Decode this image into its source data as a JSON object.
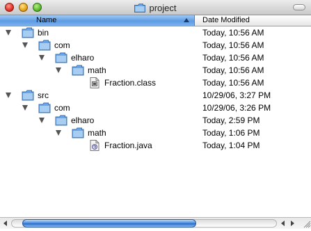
{
  "window": {
    "title": "project",
    "title_icon": "folder-icon"
  },
  "columns": {
    "name": "Name",
    "date_modified": "Date Modified",
    "sort": "ascending"
  },
  "rows": [
    {
      "name": "bin",
      "date": "Today, 10:56 AM",
      "type": "folder",
      "expanded": true
    },
    {
      "name": "com",
      "date": "Today, 10:56 AM",
      "type": "folder",
      "expanded": true
    },
    {
      "name": "elharo",
      "date": "Today, 10:56 AM",
      "type": "folder",
      "expanded": true
    },
    {
      "name": "math",
      "date": "Today, 10:56 AM",
      "type": "folder",
      "expanded": true
    },
    {
      "name": "Fraction.class",
      "date": "Today, 10:56 AM",
      "type": "class-file"
    },
    {
      "name": "src",
      "date": "10/29/06, 3:27 PM",
      "type": "folder",
      "expanded": true
    },
    {
      "name": "com",
      "date": "10/29/06, 3:26 PM",
      "type": "folder",
      "expanded": true
    },
    {
      "name": "elharo",
      "date": "Today, 2:59 PM",
      "type": "folder",
      "expanded": true
    },
    {
      "name": "math",
      "date": "Today, 1:06 PM",
      "type": "folder",
      "expanded": true
    },
    {
      "name": "Fraction.java",
      "date": "Today, 1:04 PM",
      "type": "java-file"
    }
  ],
  "colors": {
    "folder_blue": "#6aa6e6",
    "header_selected": "#5d9be3",
    "scroll_thumb": "#2a6bcc"
  }
}
